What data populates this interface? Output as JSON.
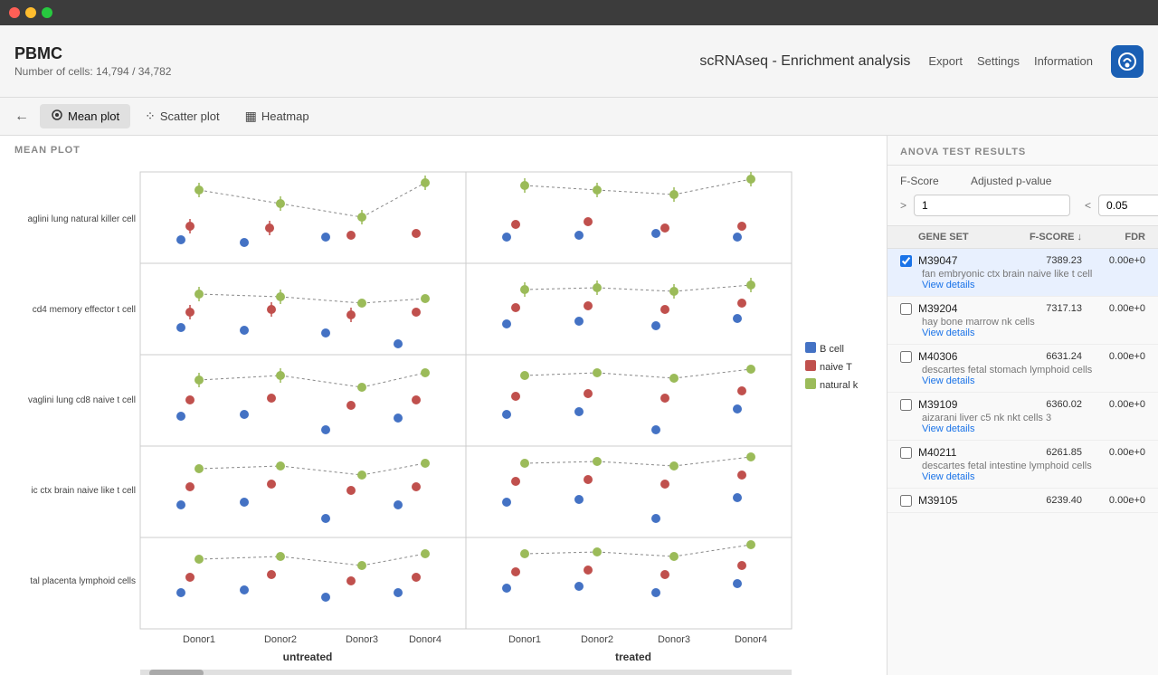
{
  "titlebar": {
    "traffic_lights": [
      "red",
      "yellow",
      "green"
    ]
  },
  "header": {
    "title": "PBMC",
    "subtitle": "Number of cells: 14,794 / 34,782",
    "app_title": "scRNAseq - Enrichment analysis",
    "actions": [
      "Export",
      "Settings",
      "Information"
    ],
    "app_icon": "🔬"
  },
  "toolbar": {
    "back_label": "←",
    "tabs": [
      {
        "id": "mean-plot",
        "label": "Mean plot",
        "icon": "⊙",
        "active": true
      },
      {
        "id": "scatter-plot",
        "label": "Scatter plot",
        "icon": "⁘",
        "active": false
      },
      {
        "id": "heatmap",
        "label": "Heatmap",
        "icon": "▦",
        "active": false
      }
    ]
  },
  "plot": {
    "section_label": "MEAN PLOT",
    "y_labels": [
      "aglini lung natural killer cell",
      "cd4 memory effector t cell",
      "vaglini lung cd8 naive t cell",
      "ic ctx brain naive like t cell",
      "tal placenta lymphoid cells"
    ],
    "x_labels": [
      "Donor1",
      "Donor2",
      "Donor3",
      "Donor4",
      "Donor1",
      "Donor2",
      "Donor3",
      "Donor4"
    ],
    "group_labels": [
      "untreated",
      "treated"
    ],
    "legend": [
      {
        "label": "B cell",
        "color": "#4472C4"
      },
      {
        "label": "naive T",
        "color": "#C0504D"
      },
      {
        "label": "natural k",
        "color": "#9BBB59"
      }
    ]
  },
  "anova": {
    "section_label": "ANOVA TEST RESULTS",
    "filters": {
      "fscore_label": "F-Score",
      "fscore_prefix": "> ",
      "fscore_value": "1",
      "pvalue_label": "Adjusted p-value",
      "pvalue_prefix": "< ",
      "pvalue_value": "0.05"
    },
    "table_headers": {
      "check": "",
      "gene_set": "GENE SET",
      "fscore": "F-SCORE ↓",
      "fdr": "FDR"
    },
    "rows": [
      {
        "id": "M39047",
        "selected": true,
        "gene_set": "M39047",
        "fscore": "7389.23",
        "fdr": "0.00e+0",
        "description": "fan embryonic ctx brain naive like t cell",
        "link": "View details"
      },
      {
        "id": "M39204",
        "selected": false,
        "gene_set": "M39204",
        "fscore": "7317.13",
        "fdr": "0.00e+0",
        "description": "hay bone marrow nk cells",
        "link": "View details"
      },
      {
        "id": "M40306",
        "selected": false,
        "gene_set": "M40306",
        "fscore": "6631.24",
        "fdr": "0.00e+0",
        "description": "descartes fetal stomach lymphoid cells",
        "link": "View details"
      },
      {
        "id": "M39109",
        "selected": false,
        "gene_set": "M39109",
        "fscore": "6360.02",
        "fdr": "0.00e+0",
        "description": "aizarani liver c5 nk nkt cells 3",
        "link": "View details"
      },
      {
        "id": "M40211",
        "selected": false,
        "gene_set": "M40211",
        "fscore": "6261.85",
        "fdr": "0.00e+0",
        "description": "descartes fetal intestine lymphoid cells",
        "link": "View details"
      },
      {
        "id": "M39105",
        "selected": false,
        "gene_set": "M39105",
        "fscore": "6239.40",
        "fdr": "0.00e+0",
        "description": "",
        "link": ""
      }
    ]
  }
}
